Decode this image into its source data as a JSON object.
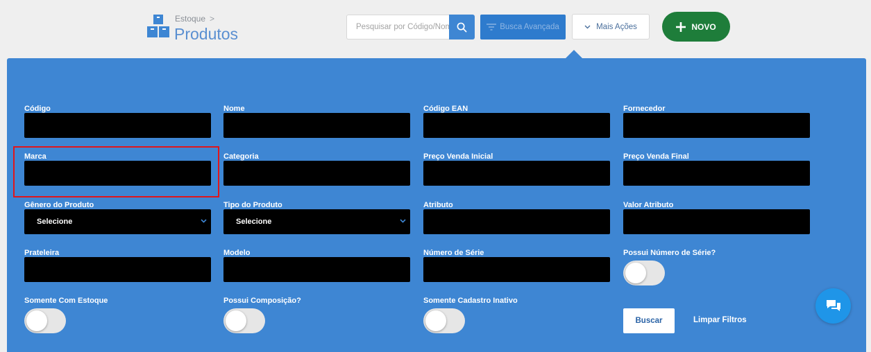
{
  "header": {
    "breadcrumb_parent": "Estoque",
    "breadcrumb_sep": ">",
    "title": "Produtos",
    "search_placeholder": "Pesquisar por Código/Nome",
    "advanced_search_label": "Busca Avançada",
    "more_actions_label": "Mais Ações",
    "new_label": "NOVO"
  },
  "filters": {
    "codigo": "Código",
    "nome": "Nome",
    "codigo_ean": "Código EAN",
    "fornecedor": "Fornecedor",
    "marca": "Marca",
    "categoria": "Categoria",
    "preco_inicial": "Preço Venda Inicial",
    "preco_final": "Preço Venda Final",
    "genero": "Gênero do Produto",
    "genero_value": "Selecione",
    "tipo": "Tipo do Produto",
    "tipo_value": "Selecione",
    "atributo": "Atributo",
    "valor_atributo": "Valor Atributo",
    "prateleira": "Prateleira",
    "modelo": "Modelo",
    "numero_serie": "Número de Série",
    "possui_numero_serie": "Possui Número de Série?",
    "somente_estoque": "Somente Com Estoque",
    "possui_composicao": "Possui Composição?",
    "somente_inativo": "Somente Cadastro Inativo"
  },
  "actions": {
    "buscar_label": "Buscar",
    "limpar_label": "Limpar Filtros"
  },
  "colors": {
    "panel": "#3e86d3",
    "accent_green": "#1e7d3a",
    "title_blue": "#5a8fd1",
    "chat": "#1f95e8",
    "highlight": "#e0161b"
  },
  "icons": [
    "boxes-icon",
    "search-icon",
    "filter-icon",
    "chevron-down-icon",
    "plus-icon",
    "chat-icon"
  ]
}
